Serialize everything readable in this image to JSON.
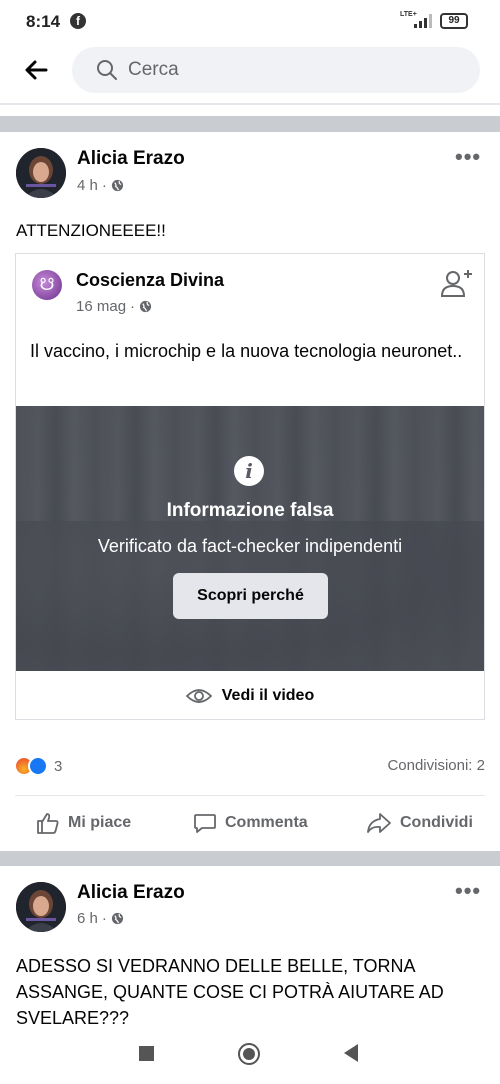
{
  "status_bar": {
    "time": "8:14",
    "app_badge": "f",
    "network": "LTE+",
    "battery": "99"
  },
  "search": {
    "placeholder": "Cerca"
  },
  "post1": {
    "author": "Alicia Erazo",
    "time": "4 h",
    "text": "ATTENZIONEEEE!!",
    "shared": {
      "page_name": "Coscienza Divina",
      "date": "16 mag",
      "text": "Il vaccino, i microchip e la nuova tecnologia neuronet..",
      "warning_title": "Informazione falsa",
      "warning_subtitle": "Verificato da fact-checker indipendenti",
      "warning_button": "Scopri perché",
      "view_video_label": "Vedi il video"
    },
    "reaction_count": "3",
    "shares": "Condivisioni: 2"
  },
  "actions": {
    "like": "Mi piace",
    "comment": "Commenta",
    "share": "Condividi"
  },
  "post2": {
    "author": "Alicia Erazo",
    "time": "6 h",
    "text": "ADESSO SI VEDRANNO DELLE BELLE, TORNA ASSANGE, QUANTE COSE CI POTRÀ AIUTARE AD SVELARE???"
  },
  "icons": [
    "back-arrow-icon",
    "search-icon",
    "globe-icon",
    "more-icon",
    "add-friend-icon",
    "info-icon",
    "eye-icon",
    "angry-reaction-icon",
    "like-reaction-icon",
    "like-icon",
    "comment-icon",
    "share-icon"
  ]
}
